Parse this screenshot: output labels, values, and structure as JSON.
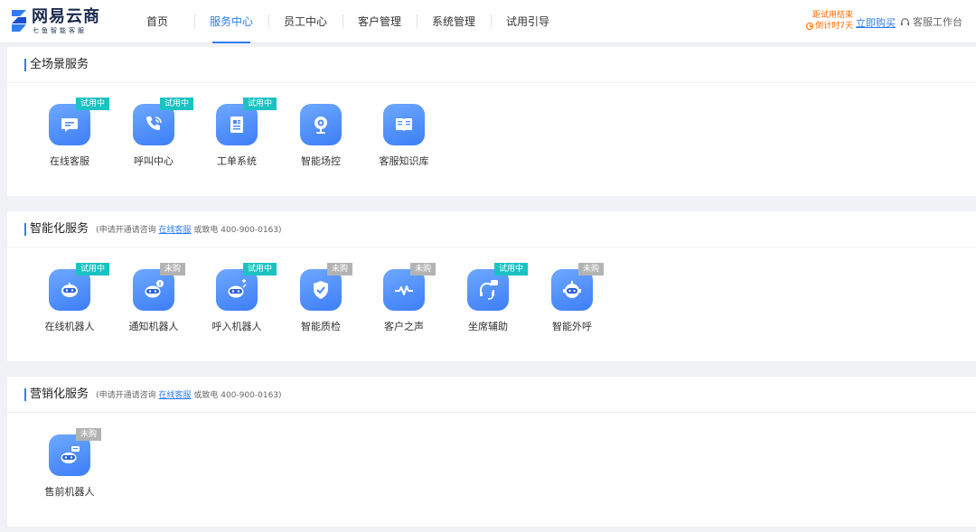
{
  "brand": {
    "title": "网易云商",
    "subtitle": "七鱼智能客服"
  },
  "nav": [
    {
      "label": "首页",
      "active": false
    },
    {
      "label": "服务中心",
      "active": true
    },
    {
      "label": "员工中心",
      "active": false
    },
    {
      "label": "客户管理",
      "active": false
    },
    {
      "label": "系统管理",
      "active": false
    },
    {
      "label": "试用引导",
      "active": false
    }
  ],
  "trial": {
    "line1": "距试用结束",
    "line2": "倒计时7天"
  },
  "buy_label": "立即购买",
  "workbench_label": "客服工作台",
  "sections": {
    "full": {
      "title": "全场景服务",
      "tiles": [
        {
          "label": "在线客服",
          "badge": "试用中",
          "icon": "chat-icon"
        },
        {
          "label": "呼叫中心",
          "badge": "试用中",
          "icon": "phone-icon"
        },
        {
          "label": "工单系统",
          "badge": "试用中",
          "icon": "document-icon"
        },
        {
          "label": "智能场控",
          "badge": "",
          "icon": "webcam-icon"
        },
        {
          "label": "客服知识库",
          "badge": "",
          "icon": "book-icon"
        }
      ]
    },
    "smart": {
      "title": "智能化服务",
      "note_prefix": "(申请开通请咨询 ",
      "note_link": "在线客服",
      "note_suffix": " 或致电 400-900-0163)",
      "tiles": [
        {
          "label": "在线机器人",
          "badge": "试用中",
          "icon": "robot-icon"
        },
        {
          "label": "通知机器人",
          "badge": "未购",
          "icon": "robot-notify-icon"
        },
        {
          "label": "呼入机器人",
          "badge": "试用中",
          "icon": "robot-inbound-icon"
        },
        {
          "label": "智能质检",
          "badge": "未购",
          "icon": "shield-check-icon"
        },
        {
          "label": "客户之声",
          "badge": "未购",
          "icon": "pulse-icon"
        },
        {
          "label": "坐席辅助",
          "badge": "试用中",
          "icon": "headset-ai-icon"
        },
        {
          "label": "智能外呼",
          "badge": "未购",
          "icon": "robot-outbound-icon"
        }
      ]
    },
    "marketing": {
      "title": "营销化服务",
      "note_prefix": "(申请开通请咨询 ",
      "note_link": "在线客服",
      "note_suffix": " 或致电 400-900-0163)",
      "tiles": [
        {
          "label": "售前机器人",
          "badge": "未购",
          "icon": "robot-presale-icon"
        }
      ]
    }
  },
  "colors": {
    "accent": "#2f7cf6",
    "trial_badge": "#1bc2c2",
    "unbought_badge": "#b3b3b3",
    "warning": "#ff6a00"
  }
}
